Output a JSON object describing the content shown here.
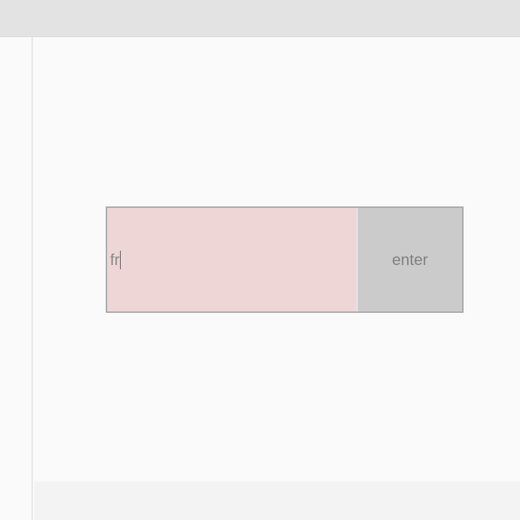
{
  "form": {
    "input_value": "fr",
    "enter_label": "enter"
  },
  "colors": {
    "input_background": "#eed6d6",
    "button_background": "#cbcbcb",
    "frame_border": "#a9a9a9",
    "text": "#8a8a8a"
  }
}
